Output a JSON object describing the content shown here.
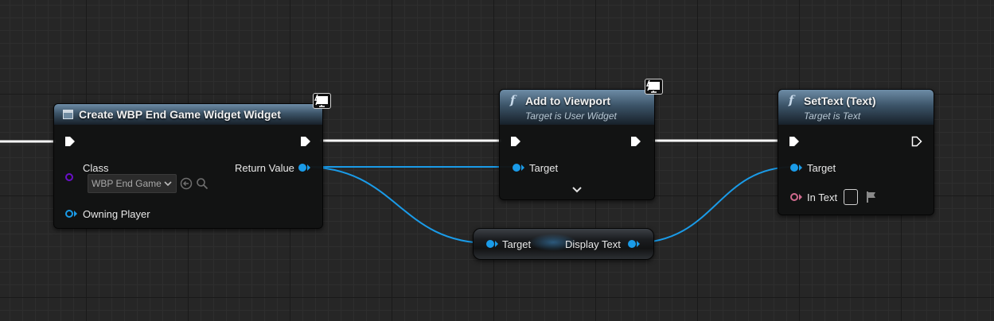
{
  "colors": {
    "exec_wire": "#ffffff",
    "object_wire": "#1a9be8",
    "class_pin": "#6a10c8",
    "text_pin": "#d06a8e"
  },
  "create_widget_node": {
    "title": "Create WBP End Game Widget Widget",
    "icon": "widget-icon",
    "badge_icon": "monitor-lightning-icon",
    "class_label": "Class",
    "class_value": "WBP End Game",
    "owning_player_label": "Owning Player",
    "return_value_label": "Return Value"
  },
  "add_to_viewport_node": {
    "title": "Add to Viewport",
    "subtitle": "Target is User Widget",
    "icon": "function-icon",
    "badge_icon": "monitor-lightning-icon",
    "target_label": "Target",
    "expand_icon": "chevron-down-icon"
  },
  "set_text_node": {
    "title": "SetText (Text)",
    "subtitle": "Target is Text",
    "icon": "function-icon",
    "target_label": "Target",
    "in_text_label": "In Text",
    "in_text_value": ""
  },
  "get_display_text_node": {
    "target_label": "Target",
    "output_label": "Display Text"
  }
}
